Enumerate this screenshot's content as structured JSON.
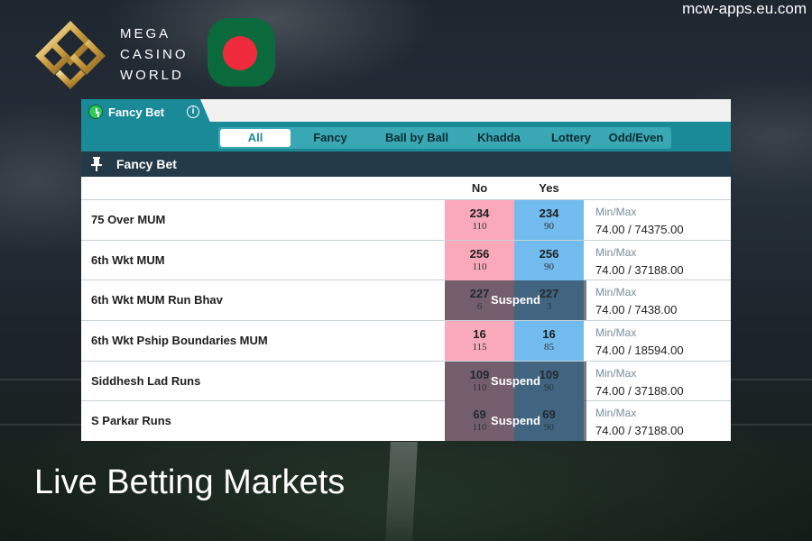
{
  "site": {
    "url": "mcw-apps.eu.com"
  },
  "brand": {
    "lines": [
      "MEGA",
      "CASINO",
      "WORLD"
    ]
  },
  "colors": {
    "accent": "#1a8a99",
    "header_dark": "#243a48",
    "no": "#f9a9ba",
    "yes": "#72bbef",
    "flag_green": "#0b6a3b",
    "flag_red": "#ee2a3c"
  },
  "tab": {
    "label": "Fancy Bet",
    "icon": "alarm-clock-icon",
    "info_icon": "info-icon"
  },
  "filters": [
    {
      "label": "All",
      "active": true
    },
    {
      "label": "Fancy",
      "active": false
    },
    {
      "label": "Ball by Ball",
      "active": false
    },
    {
      "label": "Khadda",
      "active": false
    },
    {
      "label": "Lottery",
      "active": false
    },
    {
      "label": "Odd/Even",
      "active": false
    }
  ],
  "section": {
    "title": "Fancy Bet",
    "icon": "pin-icon"
  },
  "columns": {
    "no": "No",
    "yes": "Yes"
  },
  "rows": [
    {
      "name": "75 Over MUM",
      "no_price": "234",
      "no_size": "110",
      "yes_price": "234",
      "yes_size": "90",
      "suspended": false,
      "minmax_label": "Min/Max",
      "minmax": "74.00 / 74375.00"
    },
    {
      "name": "6th Wkt MUM",
      "no_price": "256",
      "no_size": "110",
      "yes_price": "256",
      "yes_size": "90",
      "suspended": false,
      "minmax_label": "Min/Max",
      "minmax": "74.00 / 37188.00"
    },
    {
      "name": "6th Wkt MUM Run Bhav",
      "no_price": "227",
      "no_size": "6",
      "yes_price": "227",
      "yes_size": "3",
      "suspended": true,
      "suspend_label": "Suspend",
      "minmax_label": "Min/Max",
      "minmax": "74.00 / 7438.00"
    },
    {
      "name": "6th Wkt Pship Boundaries MUM",
      "no_price": "16",
      "no_size": "115",
      "yes_price": "16",
      "yes_size": "85",
      "suspended": false,
      "minmax_label": "Min/Max",
      "minmax": "74.00 / 18594.00"
    },
    {
      "name": "Siddhesh Lad Runs",
      "no_price": "109",
      "no_size": "110",
      "yes_price": "109",
      "yes_size": "90",
      "suspended": true,
      "suspend_label": "Suspend",
      "minmax_label": "Min/Max",
      "minmax": "74.00 / 37188.00"
    },
    {
      "name": "S Parkar Runs",
      "no_price": "69",
      "no_size": "110",
      "yes_price": "69",
      "yes_size": "90",
      "suspended": true,
      "suspend_label": "Suspend",
      "minmax_label": "Min/Max",
      "minmax": "74.00 / 37188.00"
    }
  ],
  "caption": "Live Betting Markets"
}
